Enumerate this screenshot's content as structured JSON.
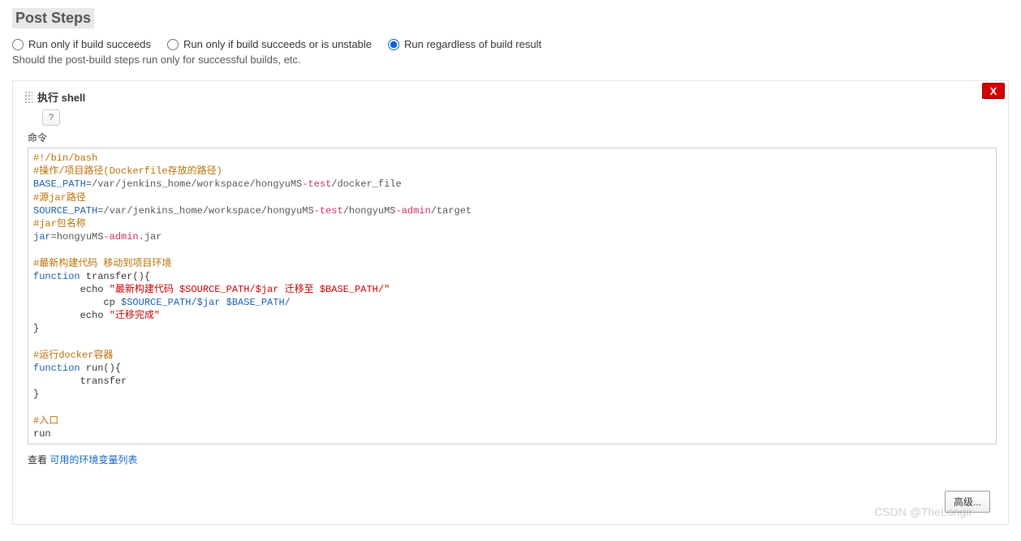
{
  "section_title": "Post Steps",
  "radios": {
    "opt1": "Run only if build succeeds",
    "opt2": "Run only if build succeeds or is unstable",
    "opt3": "Run regardless of build result",
    "selected": "opt3"
  },
  "hint": "Should the post-build steps run only for successful builds, etc.",
  "step": {
    "title": "执行 shell",
    "help": "?",
    "field_label": "命令",
    "delete_label": "X"
  },
  "script": {
    "l01": "#!/bin/bash",
    "l02": "#操作/项目路径(Dockerfile存放的路径)",
    "l03a": "BASE_PATH",
    "l03b": "=/var/jenkins_home/workspace/hongyuMS",
    "l03c": "-test",
    "l03d": "/docker_file",
    "l04": "#源jar路径",
    "l05a": "SOURCE_PATH",
    "l05b": "=/var/jenkins_home/workspace/hongyuMS",
    "l05c": "-test",
    "l05d": "/hongyuMS",
    "l05e": "-admin",
    "l05f": "/target",
    "l06": "#jar包名称",
    "l07a": "jar",
    "l07b": "=hongyuMS",
    "l07c": "-admin.",
    "l07d": "jar",
    "l09": "#最新构建代码 移动到项目环境",
    "l10a": "function",
    "l10b": " transfer(){",
    "l11a": "        echo ",
    "l11b": "\"最新构建代码 $SOURCE_PATH/$jar 迁移至 $BASE_PATH/\"",
    "l12a": "            cp ",
    "l12b": "$SOURCE_PATH/$jar $BASE_PATH/",
    "l13a": "        echo ",
    "l13b": "\"迁移完成\"",
    "l14": "}",
    "l16": "#运行docker容器",
    "l17a": "function",
    "l17b": " run(){",
    "l18": "        transfer",
    "l19": "}",
    "l21": "#入口",
    "l22": "run"
  },
  "footer": {
    "prefix": "查看 ",
    "link": "可用的环境变量列表"
  },
  "advanced_label": "高级...",
  "watermark": "CSDN @TheLongir"
}
